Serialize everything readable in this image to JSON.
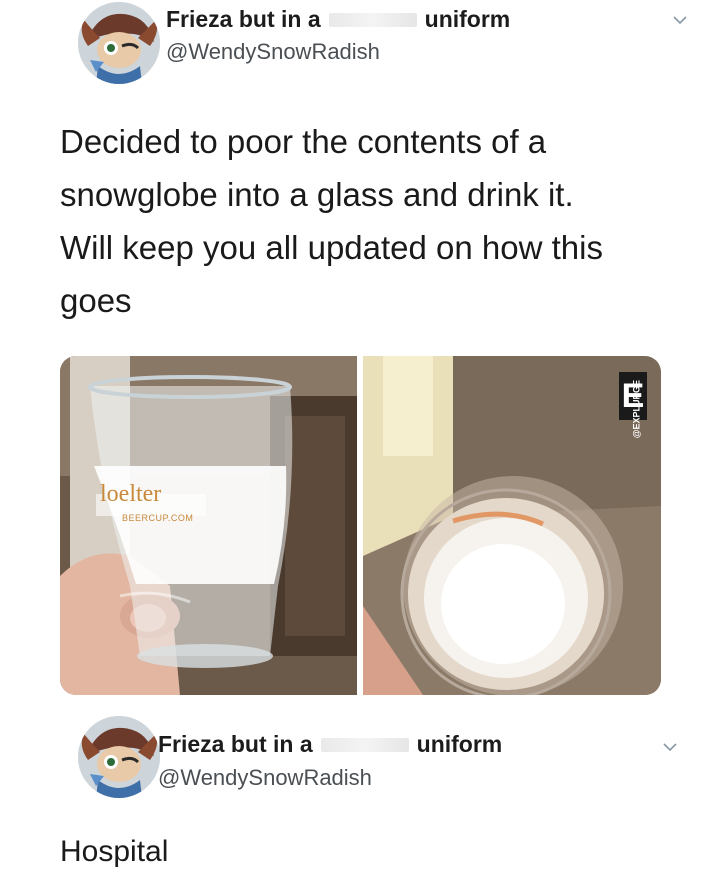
{
  "tweets": [
    {
      "author": {
        "name_before": "Frieza but in a",
        "name_after": "uniform",
        "handle": "@WendySnowRadish",
        "avatar_icon": "cartoon-character-avatar-icon"
      },
      "text_lines": [
        "Decided to poor the contents of a",
        "snowglobe into a glass and drink it.",
        "Will keep you all updated on how this",
        "goes"
      ],
      "media": {
        "left_photo": {
          "glass_brand": "loelter",
          "glass_url": "BEERCUP.COM"
        },
        "right_photo": {
          "watermark": "@EXPLURGE",
          "watermark_logo": "E"
        }
      }
    },
    {
      "author": {
        "name_before": "Frieza but in a",
        "name_after": "uniform",
        "handle": "@WendySnowRadish",
        "avatar_icon": "cartoon-character-avatar-icon"
      },
      "text": "Hospital"
    }
  ],
  "colors": {
    "text": "#14171a",
    "handle": "#4a4f54",
    "chevron": "#8899a6"
  }
}
